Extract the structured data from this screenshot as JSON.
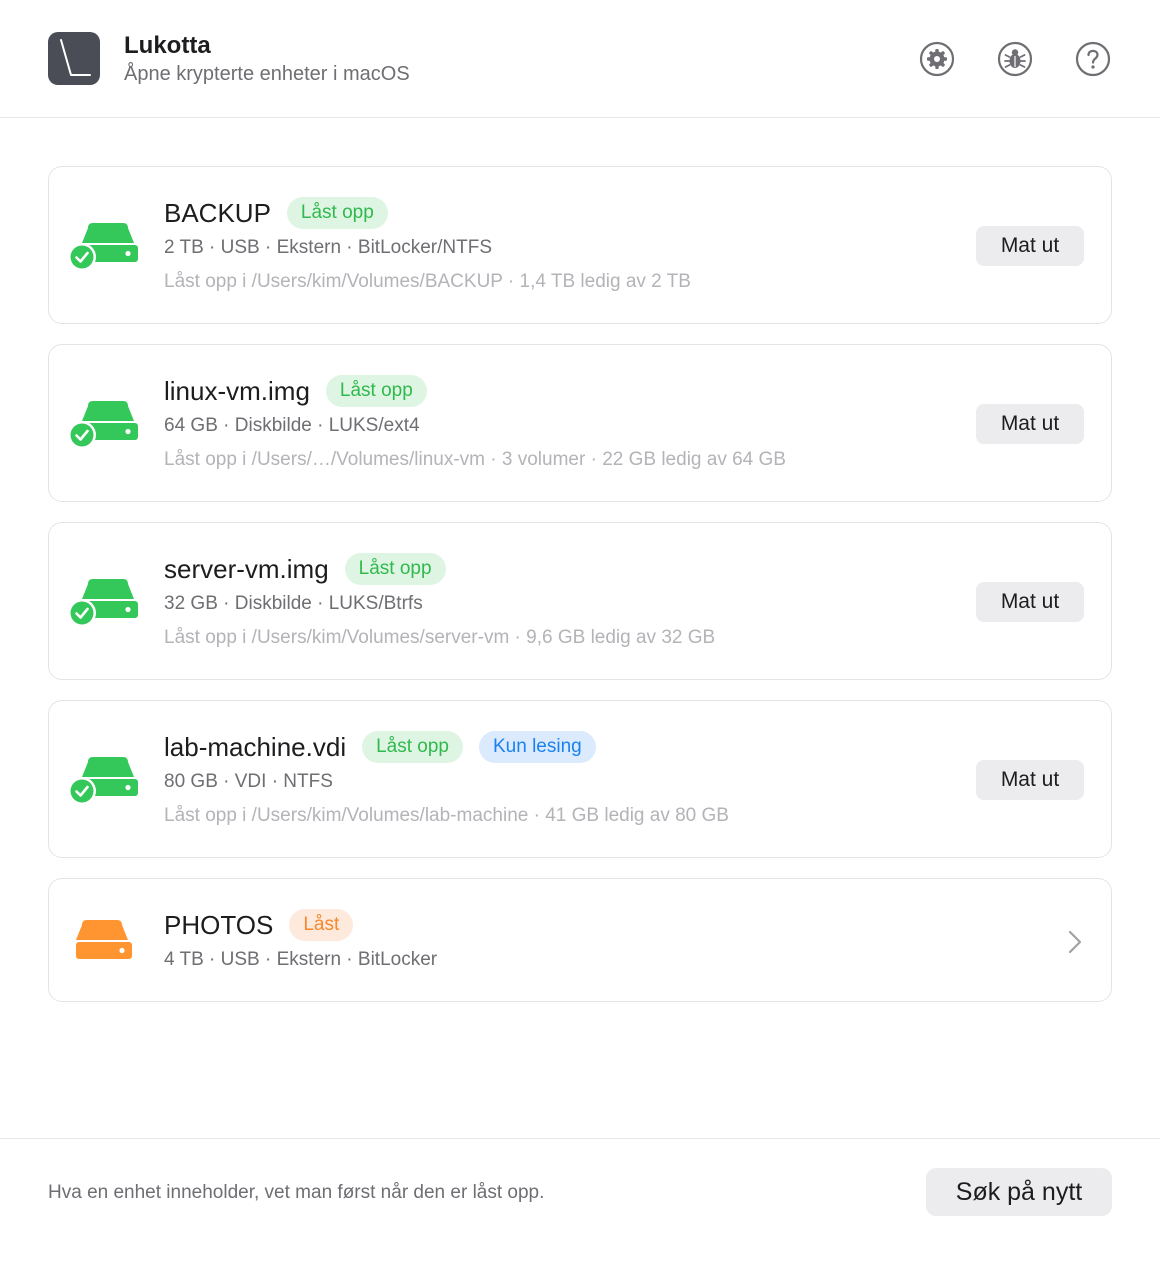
{
  "app": {
    "title": "Lukotta",
    "subtitle": "Åpne krypterte enheter i macOS"
  },
  "header_actions": [
    {
      "icon": "gear-icon"
    },
    {
      "icon": "bug-icon"
    },
    {
      "icon": "help-icon"
    }
  ],
  "devices": [
    {
      "name": "BACKUP",
      "status": "unlocked",
      "badges": [
        {
          "label": "Låst opp",
          "color": "green"
        }
      ],
      "meta": "2 TB  ·  USB · Ekstern  ·  BitLocker/NTFS",
      "path": "Låst opp i /Users/kim/Volumes/BACKUP  ·  1,4 TB ledig av 2 TB",
      "action": "Mat ut"
    },
    {
      "name": "linux-vm.img",
      "status": "unlocked",
      "badges": [
        {
          "label": "Låst opp",
          "color": "green"
        }
      ],
      "meta": "64 GB  ·  Diskbilde  ·  LUKS/ext4",
      "path": "Låst opp i /Users/…/Volumes/linux-vm  ·  3 volumer  ·  22 GB ledig av 64 GB",
      "action": "Mat ut"
    },
    {
      "name": "server-vm.img",
      "status": "unlocked",
      "badges": [
        {
          "label": "Låst opp",
          "color": "green"
        }
      ],
      "meta": "32 GB  ·  Diskbilde  ·  LUKS/Btrfs",
      "path": "Låst opp i /Users/kim/Volumes/server-vm  ·  9,6 GB ledig av 32 GB",
      "action": "Mat ut"
    },
    {
      "name": "lab-machine.vdi",
      "status": "unlocked",
      "badges": [
        {
          "label": "Låst opp",
          "color": "green"
        },
        {
          "label": "Kun lesing",
          "color": "blue"
        }
      ],
      "meta": "80 GB  ·  VDI  ·  NTFS",
      "path": "Låst opp i /Users/kim/Volumes/lab-machine  ·  41 GB ledig av 80 GB",
      "action": "Mat ut"
    },
    {
      "name": "PHOTOS",
      "status": "locked",
      "badges": [
        {
          "label": "Låst",
          "color": "orange"
        }
      ],
      "meta": "4 TB  ·  USB · Ekstern  ·  BitLocker",
      "path": "",
      "action": ""
    }
  ],
  "colors": {
    "unlocked": "#34c759",
    "locked": "#ff9530",
    "badge_green_bg": "#dff5e3",
    "badge_blue_bg": "#dbeafd",
    "badge_orange_bg": "#feeadd"
  },
  "footer": {
    "note": "Hva en enhet inneholder, vet man først når den er låst opp.",
    "rescan_label": "Søk på nytt"
  }
}
